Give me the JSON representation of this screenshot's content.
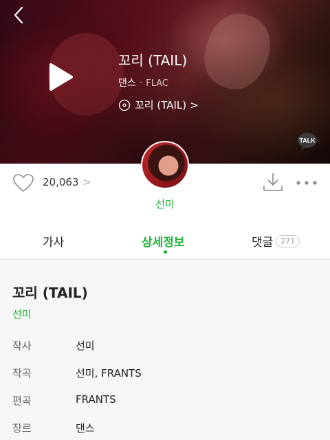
{
  "hero": {
    "title": "꼬리 (TAIL)",
    "genre": "댄스",
    "separator": "·",
    "format": "FLAC",
    "album": "꼬리 (TAIL)",
    "album_chevron": ">",
    "talk_label": "TALK"
  },
  "artist": {
    "name": "선미"
  },
  "actions": {
    "like_count": "20,063",
    "like_chevron": ">"
  },
  "tabs": {
    "lyrics": "가사",
    "detail": "상세정보",
    "comments": "댓글",
    "comment_count": "271"
  },
  "detail": {
    "title": "꼬리 (TAIL)",
    "artist": "선미",
    "rows": [
      {
        "label": "작사",
        "value": "선미"
      },
      {
        "label": "작곡",
        "value": "선미, FRANTS"
      },
      {
        "label": "편곡",
        "value": "FRANTS"
      },
      {
        "label": "장르",
        "value": "댄스"
      }
    ]
  },
  "colors": {
    "accent": "#1fb335",
    "text": "#222222",
    "muted": "#999999",
    "detail_bg": "#f7f7f7"
  }
}
